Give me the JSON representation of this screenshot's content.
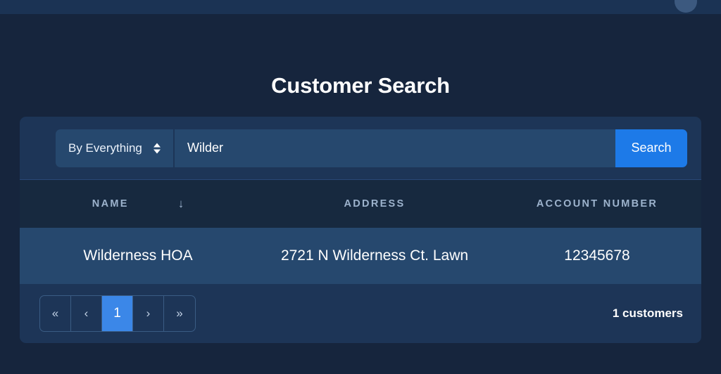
{
  "topbar": {
    "avatar_label": "user-avatar"
  },
  "header": {
    "title": "Customer Search"
  },
  "search": {
    "type_selected": "By Everything",
    "type_options": [
      "By Everything"
    ],
    "query_value": "Wilder",
    "query_placeholder": "",
    "submit_label": "Search"
  },
  "table": {
    "columns": [
      {
        "key": "name",
        "label": "NAME",
        "sort_icon": "↓",
        "sorted": true
      },
      {
        "key": "address",
        "label": "ADDRESS",
        "sorted": false
      },
      {
        "key": "account",
        "label": "ACCOUNT NUMBER",
        "sorted": false
      }
    ],
    "rows": [
      {
        "name": "Wilderness HOA",
        "address": "2721 N Wilderness Ct. Lawn",
        "account": "12345678"
      }
    ]
  },
  "pagination": {
    "first_label": "«",
    "prev_label": "‹",
    "pages": [
      "1"
    ],
    "current_page": "1",
    "next_label": "›",
    "last_label": "»"
  },
  "footer": {
    "result_count": "1 customers"
  },
  "colors": {
    "page_background": "#16253d",
    "topbar": "#1b3354",
    "panel": "#1d3557",
    "field": "#26486e",
    "header_row": "#17293f",
    "accent_blue": "#1d7ae8",
    "page_active": "#3b87e8",
    "muted_text": "#9db3cd"
  }
}
